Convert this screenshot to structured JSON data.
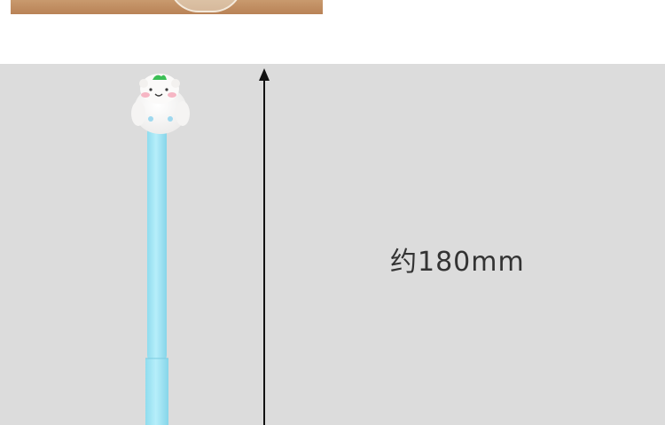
{
  "dimension": {
    "label": "约180mm"
  },
  "colors": {
    "background": "#dcdcdc",
    "pen_body": "#a7e8f6",
    "arrow": "#111111"
  }
}
